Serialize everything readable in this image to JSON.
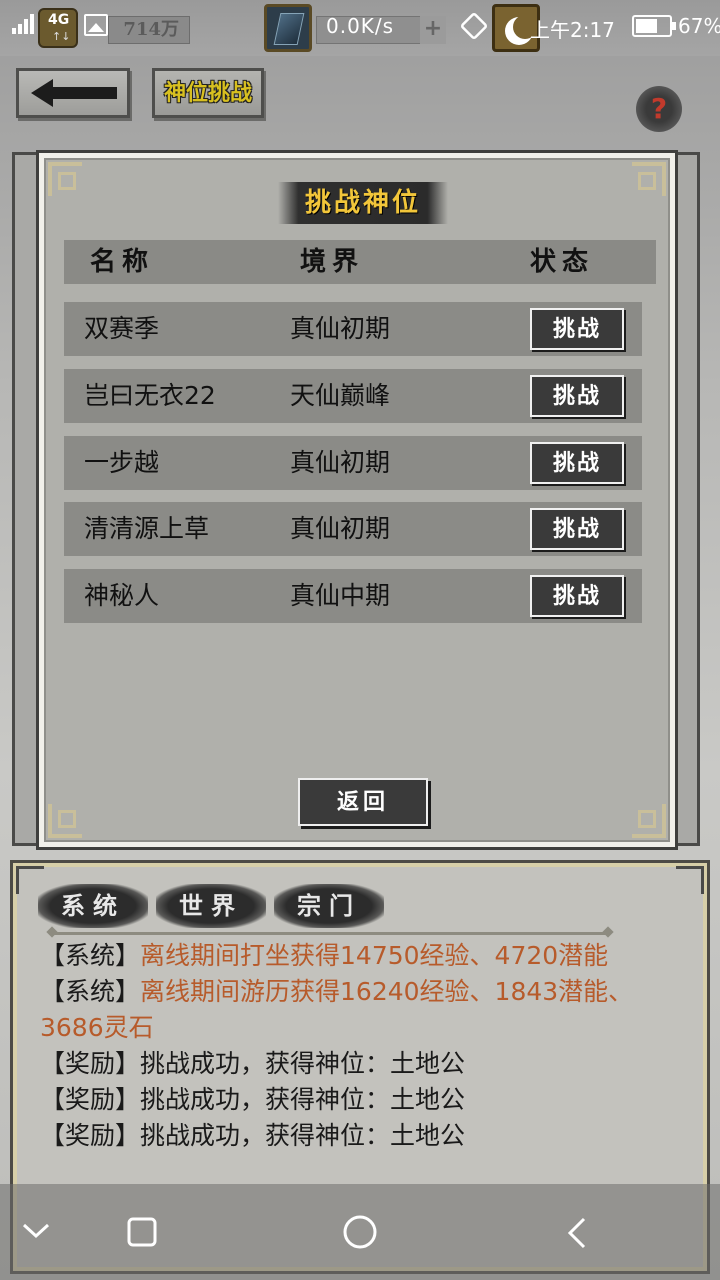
{
  "status_bar": {
    "network": "4G",
    "network_arrows": "↑↓",
    "currency": "714万",
    "speed": "0.0K/s",
    "plus": "+",
    "time": "上午2:17",
    "battery_pct": "67%",
    "battery_level": 0.67
  },
  "header": {
    "title_tag": "神位挑战",
    "help": "?"
  },
  "dialog": {
    "title": "挑战神位",
    "columns": {
      "name": "名称",
      "realm": "境界",
      "status": "状态"
    },
    "rows": [
      {
        "name": "双赛季",
        "realm": "真仙初期",
        "action": "挑战"
      },
      {
        "name": "岂曰无衣22",
        "realm": "天仙巅峰",
        "action": "挑战"
      },
      {
        "name": "一步越",
        "realm": "真仙初期",
        "action": "挑战"
      },
      {
        "name": "清清源上草",
        "realm": "真仙初期",
        "action": "挑战"
      },
      {
        "name": "神秘人",
        "realm": "真仙中期",
        "action": "挑战"
      }
    ],
    "return_label": "返回"
  },
  "messages": {
    "tabs": [
      "系统",
      "世界",
      "宗门"
    ],
    "lines": [
      {
        "tag": "【系统】",
        "text": "离线期间打坐获得14750经验、4720潜能",
        "color": "orange"
      },
      {
        "tag": "【系统】",
        "text": "离线期间游历获得16240经验、1843潜能、",
        "color": "orange"
      },
      {
        "tag": "",
        "text": "3686灵石",
        "color": "orange"
      },
      {
        "tag": "【奖励】",
        "text": "挑战成功，获得神位：土地公",
        "color": "dark"
      },
      {
        "tag": "【奖励】",
        "text": "挑战成功，获得神位：土地公",
        "color": "dark"
      },
      {
        "tag": "【奖励】",
        "text": "挑战成功，获得神位：土地公",
        "color": "dark"
      }
    ]
  },
  "nav": [
    "collapse-icon",
    "recents-icon",
    "home-icon",
    "back-icon"
  ],
  "colors": {
    "orange_text": "#b75b2b",
    "title_gold": "#f2c63a",
    "button_dark": "#3a3a3a"
  }
}
